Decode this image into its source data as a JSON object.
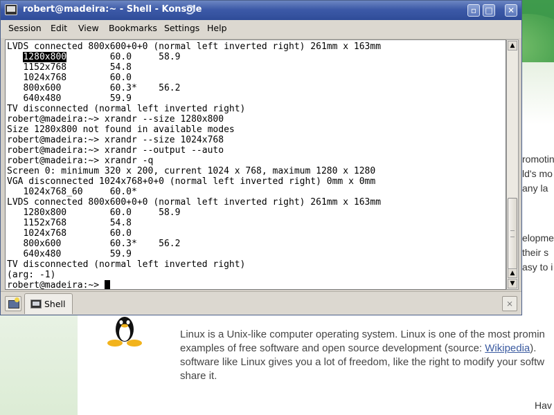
{
  "window": {
    "title": "robert@madeira:~ - Shell - Konsole",
    "controls": {
      "minimize": "▫",
      "maximize": "□",
      "close": "✕"
    }
  },
  "menu": [
    "Session",
    "Edit",
    "View",
    "Bookmarks",
    "Settings",
    "Help"
  ],
  "terminal": {
    "lines": [
      "LVDS connected 800x600+0+0 (normal left inverted right) 261mm x 163mm",
      "   1280x800        60.0     58.9",
      "   1152x768        54.8",
      "   1024x768        60.0",
      "   800x600         60.3*    56.2",
      "   640x480         59.9",
      "TV disconnected (normal left inverted right)",
      "robert@madeira:~> xrandr --size 1280x800",
      "Size 1280x800 not found in available modes",
      "robert@madeira:~> xrandr --size 1024x768",
      "robert@madeira:~> xrandr --output --auto",
      "robert@madeira:~> xrandr -q",
      "Screen 0: minimum 320 x 200, current 1024 x 768, maximum 1280 x 1280",
      "VGA disconnected 1024x768+0+0 (normal left inverted right) 0mm x 0mm",
      "   1024x768_60     60.0*",
      "LVDS connected 800x600+0+0 (normal left inverted right) 261mm x 163mm",
      "   1280x800        60.0     58.9",
      "   1152x768        54.8",
      "   1024x768        60.0",
      "   800x600         60.3*    56.2",
      "   640x480         59.9",
      "TV disconnected (normal left inverted right)",
      "(arg: -1)"
    ],
    "highlight": {
      "line_index": 1,
      "text": "1280x800"
    },
    "prompt": "robert@madeira:~> "
  },
  "tabs": {
    "active_label": "Shell",
    "new_tab_icon": "new-session-icon",
    "close_tab_icon": "close-session-icon"
  },
  "background_page": {
    "fragments": [
      "romotin",
      "ld's mo",
      "any la",
      "elopme",
      "their s",
      "asy to i",
      "Hav"
    ],
    "paragraph": {
      "line1": "Linux is a Unix-like computer operating system. Linux is one of the most promin",
      "line2_prefix": "examples of free software and open source development (source: ",
      "line2_link": "Wikipedia",
      "line2_suffix": ").",
      "line3": "software like Linux gives you a lot of freedom, like the right to modify your softw",
      "line4": "share it."
    }
  }
}
